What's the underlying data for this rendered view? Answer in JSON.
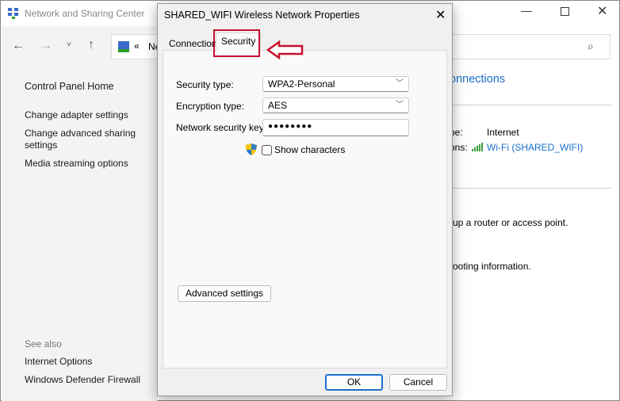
{
  "background_window": {
    "title": "Network and Sharing Center",
    "address_prefix": "«",
    "address_text": "Ne",
    "sidebar": {
      "items": [
        "Control Panel Home",
        "Change adapter settings",
        "Change advanced sharing settings",
        "Media streaming options"
      ],
      "see_also_label": "See also",
      "see_also": [
        "Internet Options",
        "Windows Defender Firewall"
      ]
    },
    "main": {
      "section_heading": "onnections",
      "access_type_label": "pe:",
      "access_type_value": "Internet",
      "connections_label": "ons:",
      "connection_link": "Wi-Fi (SHARED_WIFI)",
      "text1": "up a router or access point.",
      "text2": "ooting information."
    }
  },
  "dialog": {
    "title": "SHARED_WIFI Wireless Network Properties",
    "tabs": [
      {
        "label": "Connection"
      },
      {
        "label": "Security"
      }
    ],
    "security_type_label": "Security type:",
    "security_type_value": "WPA2-Personal",
    "encryption_type_label": "Encryption type:",
    "encryption_type_value": "AES",
    "key_label": "Network security key",
    "key_value": "●●●●●●●●",
    "show_characters_label": "Show characters",
    "show_characters_checked": false,
    "advanced_button": "Advanced settings",
    "ok_button": "OK",
    "cancel_button": "Cancel"
  },
  "annotation_color": "#c8102e"
}
